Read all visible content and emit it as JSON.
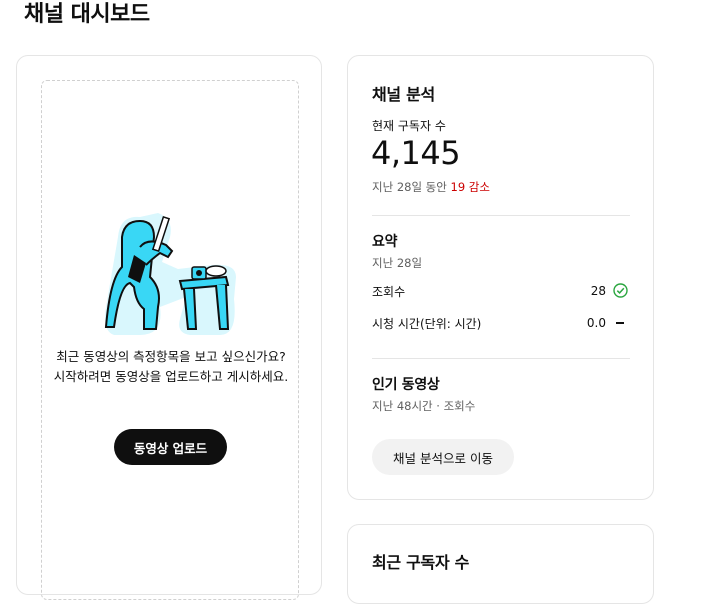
{
  "page": {
    "title": "채널 대시보드"
  },
  "upload_card": {
    "line1": "최근 동영상의 측정항목을 보고 싶으신가요?",
    "line2": "시작하려면 동영상을 업로드하고 게시하세요.",
    "button": "동영상 업로드"
  },
  "analytics": {
    "title": "채널 분석",
    "subs_label": "현재 구독자 수",
    "subs_value": "4,145",
    "change_prefix": "지난 28일 동안",
    "change_value": "19 감소",
    "summary_title": "요약",
    "summary_period": "지난 28일",
    "rows": [
      {
        "label": "조회수",
        "value": "28",
        "status": "check-circle-icon"
      },
      {
        "label": "시청 시간(단위: 시간)",
        "value": "0.0",
        "status": "dash-icon"
      }
    ],
    "popular_title": "인기 동영상",
    "popular_sub": "지난 48시간 · 조회수",
    "go_button": "채널 분석으로 이동"
  },
  "recent_subs": {
    "title": "최근 구독자 수"
  },
  "colors": {
    "accent_dark": "#0f0f0f",
    "illustration": "#39d7f5",
    "decrease": "#cc0000",
    "check": "#2ba640"
  }
}
